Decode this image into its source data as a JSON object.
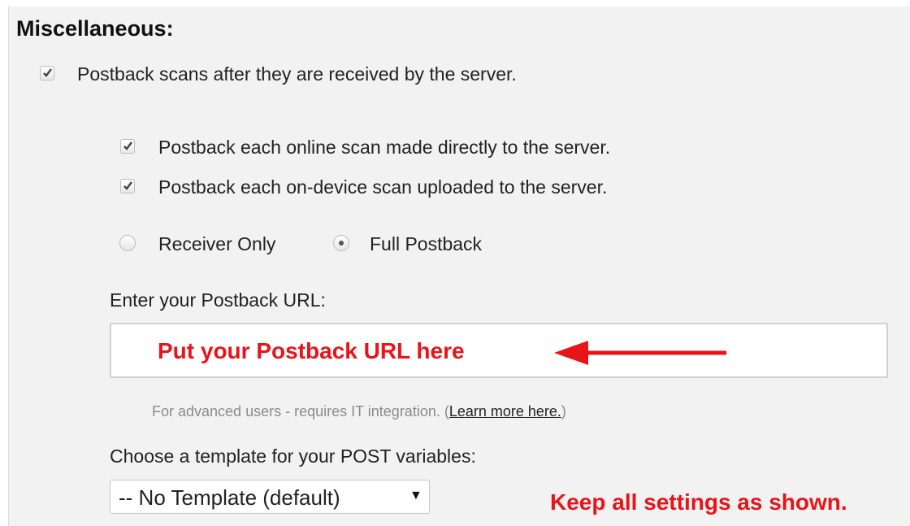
{
  "section": {
    "title": "Miscellaneous:"
  },
  "postback_scans": {
    "label": "Postback scans after they are received by the server.",
    "checked": true
  },
  "online_scan": {
    "label": "Postback each online scan made directly to the server.",
    "checked": true
  },
  "device_scan": {
    "label": "Postback each on-device scan uploaded to the server.",
    "checked": true
  },
  "mode": {
    "receiver_only_label": "Receiver Only",
    "full_postback_label": "Full Postback",
    "selected": "Full Postback"
  },
  "url_field": {
    "label": "Enter your Postback URL:",
    "value": ""
  },
  "annotations": {
    "url_hint": "Put your Postback URL here",
    "keep_settings": "Keep all settings as shown."
  },
  "help": {
    "text": "For advanced users - requires IT integration. (",
    "link": "Learn more here.",
    "close": ")"
  },
  "template": {
    "label": "Choose a template for your POST variables:",
    "selected": "-- No Template (default)"
  },
  "colors": {
    "annotation": "#e8141a",
    "panel": "#f2f2f2"
  }
}
